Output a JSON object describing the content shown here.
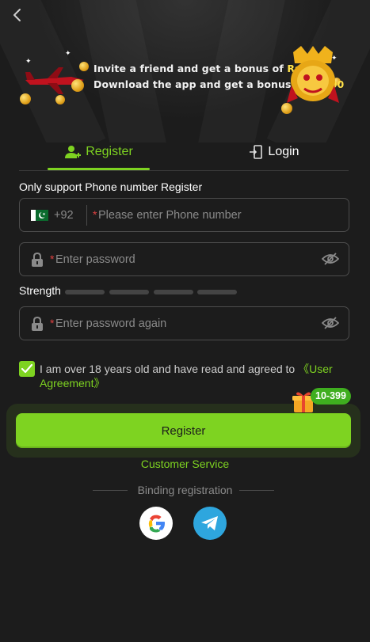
{
  "banner": {
    "line1_text": "Invite a friend and get a bonus of ",
    "line1_amount": "Rs600",
    "line2_text": "Download the app and get a bonus of ",
    "line2_amount": "Rs100"
  },
  "tabs": {
    "register_label": "Register",
    "login_label": "Login",
    "active": "register"
  },
  "form": {
    "hint": "Only support Phone number Register",
    "country_code": "+92",
    "phone_placeholder": "Please enter Phone number",
    "password_placeholder": "Enter password",
    "strength_label": "Strength",
    "strength_segments": 4,
    "confirm_placeholder": "Enter password again",
    "required_mark": "*"
  },
  "agreement": {
    "checked": true,
    "text": "I am over 18 years old and have read and agreed to ",
    "link": "《User Agreement》"
  },
  "register_button": {
    "label": "Register",
    "badge": "10-399"
  },
  "customer_service": "Customer Service",
  "binding_label": "Binding registration",
  "social": [
    "google-icon",
    "telegram-icon"
  ],
  "colors": {
    "accent": "#7ed321",
    "background": "#1c1c1c",
    "required": "#e04141",
    "banner_amount": "#ffe24a",
    "telegram": "#2ea6de"
  }
}
